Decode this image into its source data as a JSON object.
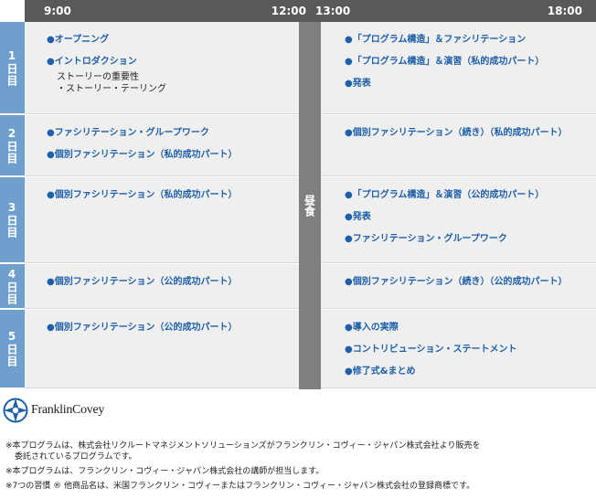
{
  "header": {
    "am_start": "9:00",
    "am_end": "12:00",
    "pm_start": "13:00",
    "pm_end": "18:00"
  },
  "lunch_label": "昼食",
  "days": [
    {
      "label": "1日目",
      "am": [
        {
          "text": "●オープニング",
          "type": "item"
        },
        {
          "text": "●イントロダクション",
          "type": "item"
        },
        {
          "text": "ストーリーの重要性",
          "type": "sub"
        },
        {
          "text": "・ストーリー・テーリング",
          "type": "sub"
        }
      ],
      "pm": [
        {
          "text": "●「プログラム構造」＆ファシリテーション",
          "type": "item"
        },
        {
          "text": "●「プログラム構造」＆演習（私的成功パート）",
          "type": "item"
        },
        {
          "text": "●発表",
          "type": "item"
        }
      ]
    },
    {
      "label": "2日目",
      "am": [
        {
          "text": "●ファシリテーション・グループワーク",
          "type": "item"
        },
        {
          "text": "●個別ファシリテーション（私的成功パート）",
          "type": "item"
        }
      ],
      "pm": [
        {
          "text": "●個別ファシリテーション（続き）（私的成功パート）",
          "type": "item"
        }
      ]
    },
    {
      "label": "3日目",
      "am": [
        {
          "text": "●個別ファシリテーション（私的成功パート）",
          "type": "item"
        }
      ],
      "pm": [
        {
          "text": "●「プログラム構造」＆演習（公的成功パート）",
          "type": "item"
        },
        {
          "text": "●発表",
          "type": "item"
        },
        {
          "text": "●ファシリテーション・グループワーク",
          "type": "item"
        }
      ]
    },
    {
      "label": "4日目",
      "am": [
        {
          "text": "●個別ファシリテーション（公的成功パート）",
          "type": "item"
        }
      ],
      "pm": [
        {
          "text": "●個別ファシリテーション（続き）（公的成功パート）",
          "type": "item"
        }
      ]
    },
    {
      "label": "5日目",
      "am": [
        {
          "text": "●個別ファシリテーション（公的成功パート）",
          "type": "item"
        }
      ],
      "pm": [
        {
          "text": "●導入の実際",
          "type": "item"
        },
        {
          "text": "●コントリビューション・ステートメント",
          "type": "item"
        },
        {
          "text": "●修了式&まとめ",
          "type": "item"
        }
      ]
    }
  ],
  "logo": {
    "text": "FranklinCovey",
    "icon": "franklincovey-compass-icon"
  },
  "notes": [
    {
      "line1": "※本プログラムは、株式会社リクルートマネジメントソリューションズがフランクリン・コヴィー・ジャパン株式会社より販売を",
      "line2": "委託されているプログラムです。"
    },
    {
      "line1": "※本プログラムは、フランクリン・コヴィー・ジャパン株式会社の講師が担当します。",
      "line2": ""
    },
    {
      "line1": "※7つの習慣 ® 他商品名は、米国フランクリン・コヴィーまたはフランクリン・コヴィー・ジャパン株式会社の登録商標です。",
      "line2": ""
    }
  ],
  "colors": {
    "day_label_bg": "#6f9fcc",
    "header_bg": "#595959",
    "lunch_bg": "#7f7f7f",
    "cell_bg": "#efefef",
    "item_text": "#1d5fa8"
  }
}
